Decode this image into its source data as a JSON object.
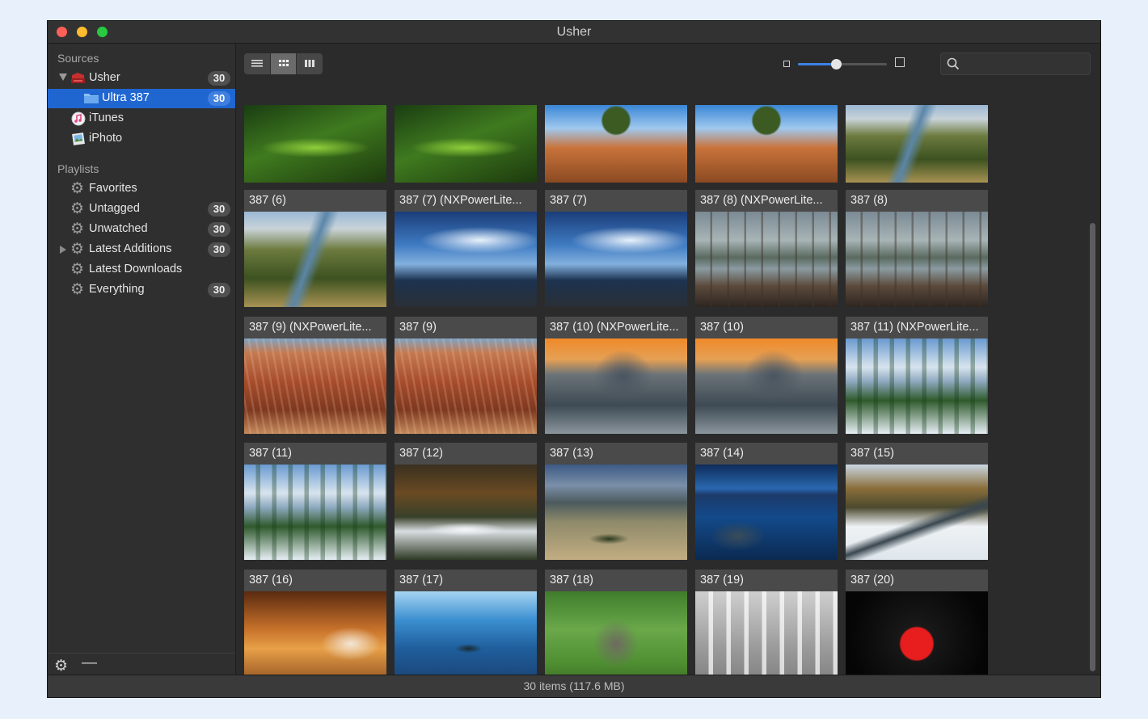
{
  "window": {
    "title": "Usher"
  },
  "sidebar": {
    "sources_label": "Sources",
    "playlists_label": "Playlists",
    "sources": [
      {
        "label": "Usher",
        "count": "30",
        "icon": "usher-icon"
      },
      {
        "label": "Ultra 387",
        "count": "30",
        "icon": "folder-icon",
        "selected": true
      },
      {
        "label": "iTunes",
        "count": "",
        "icon": "itunes-icon"
      },
      {
        "label": "iPhoto",
        "count": "",
        "icon": "iphoto-icon"
      }
    ],
    "playlists": [
      {
        "label": "Favorites",
        "count": ""
      },
      {
        "label": "Untagged",
        "count": "30"
      },
      {
        "label": "Unwatched",
        "count": "30"
      },
      {
        "label": "Latest Additions",
        "count": "30"
      },
      {
        "label": "Latest Downloads",
        "count": ""
      },
      {
        "label": "Everything",
        "count": "30"
      }
    ]
  },
  "toolbar": {
    "view_modes": [
      "list-view-icon",
      "grid-view-icon",
      "column-view-icon"
    ],
    "active_view": "grid-view-icon",
    "zoom_level": 0.43,
    "search_placeholder": ""
  },
  "grid": {
    "rows": [
      [
        {
          "caption": "",
          "theme": "grasshopper"
        },
        {
          "caption": "",
          "theme": "grasshopper"
        },
        {
          "caption": "",
          "theme": "tree-rocks"
        },
        {
          "caption": "",
          "theme": "tree-rocks"
        },
        {
          "caption": "",
          "theme": "canyon-river"
        }
      ],
      [
        {
          "caption": "387 (6)",
          "theme": "canyon-river"
        },
        {
          "caption": "387 (7) (NXPowerLite...",
          "theme": "storm-sea"
        },
        {
          "caption": "387 (7)",
          "theme": "storm-sea"
        },
        {
          "caption": "387 (8) (NXPowerLite...",
          "theme": "swamp"
        },
        {
          "caption": "387 (8)",
          "theme": "swamp"
        }
      ],
      [
        {
          "caption": "387 (9) (NXPowerLite...",
          "theme": "bryce"
        },
        {
          "caption": "387 (9)",
          "theme": "bryce"
        },
        {
          "caption": "387 (10) (NXPowerLite...",
          "theme": "halfdome"
        },
        {
          "caption": "387 (10)",
          "theme": "halfdome"
        },
        {
          "caption": "387 (11) (NXPowerLite...",
          "theme": "snow-pines"
        }
      ],
      [
        {
          "caption": "387 (11)",
          "theme": "snow-pines"
        },
        {
          "caption": "387 (12)",
          "theme": "forest-stream"
        },
        {
          "caption": "387 (13)",
          "theme": "prairie"
        },
        {
          "caption": "387 (14)",
          "theme": "lake-night"
        },
        {
          "caption": "387 (15)",
          "theme": "winter-creek"
        }
      ],
      [
        {
          "caption": "387 (16)",
          "theme": "spa"
        },
        {
          "caption": "387 (17)",
          "theme": "underwater"
        },
        {
          "caption": "387 (18)",
          "theme": "elephant"
        },
        {
          "caption": "387 (19)",
          "theme": "bulbs"
        },
        {
          "caption": "387 (20)",
          "theme": "cherry"
        }
      ]
    ]
  },
  "status": {
    "text": "30 items (117.6 MB)"
  },
  "colors": {
    "selection": "#1f66d1",
    "accent": "#3b82e6"
  }
}
